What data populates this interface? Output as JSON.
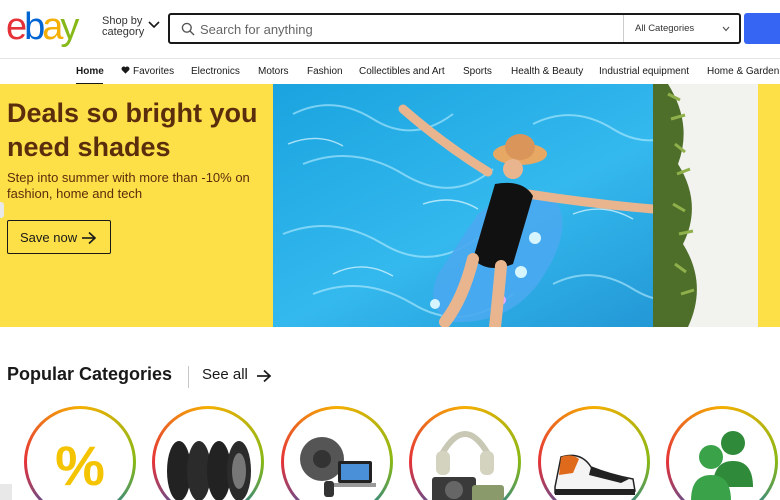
{
  "header": {
    "logo": {
      "letters": [
        "e",
        "b",
        "a",
        "y"
      ],
      "colors": [
        "#e53238",
        "#0064d2",
        "#f5af02",
        "#86b817"
      ]
    },
    "shop_by_line1": "Shop by",
    "shop_by_line2": "category",
    "search": {
      "placeholder": "Search for anything",
      "category_selected": "All Categories"
    },
    "search_button_color": "#3665f3"
  },
  "nav": {
    "items": [
      {
        "label": "Home",
        "active": true
      },
      {
        "label": "Favorites",
        "icon": "heart-icon"
      },
      {
        "label": "Electronics"
      },
      {
        "label": "Motors"
      },
      {
        "label": "Fashion"
      },
      {
        "label": "Collectibles and Art"
      },
      {
        "label": "Sports"
      },
      {
        "label": "Health & Beauty"
      },
      {
        "label": "Industrial equipment"
      },
      {
        "label": "Home & Garden"
      }
    ]
  },
  "hero": {
    "title": "Deals so bright you need shades",
    "subtitle": "Step into summer with more than -10% on fashion, home and tech",
    "button_label": "Save now",
    "background_color": "#fde047",
    "text_color": "#5a2d0c"
  },
  "popular": {
    "title": "Popular Categories",
    "see_all": "See all",
    "categories": [
      {
        "icon": "percent-deals-icon"
      },
      {
        "icon": "tires-icon"
      },
      {
        "icon": "robot-vacuum-laptop-icon"
      },
      {
        "icon": "headphones-camera-icon"
      },
      {
        "icon": "sneaker-icon"
      },
      {
        "icon": "users-group-icon"
      }
    ]
  }
}
